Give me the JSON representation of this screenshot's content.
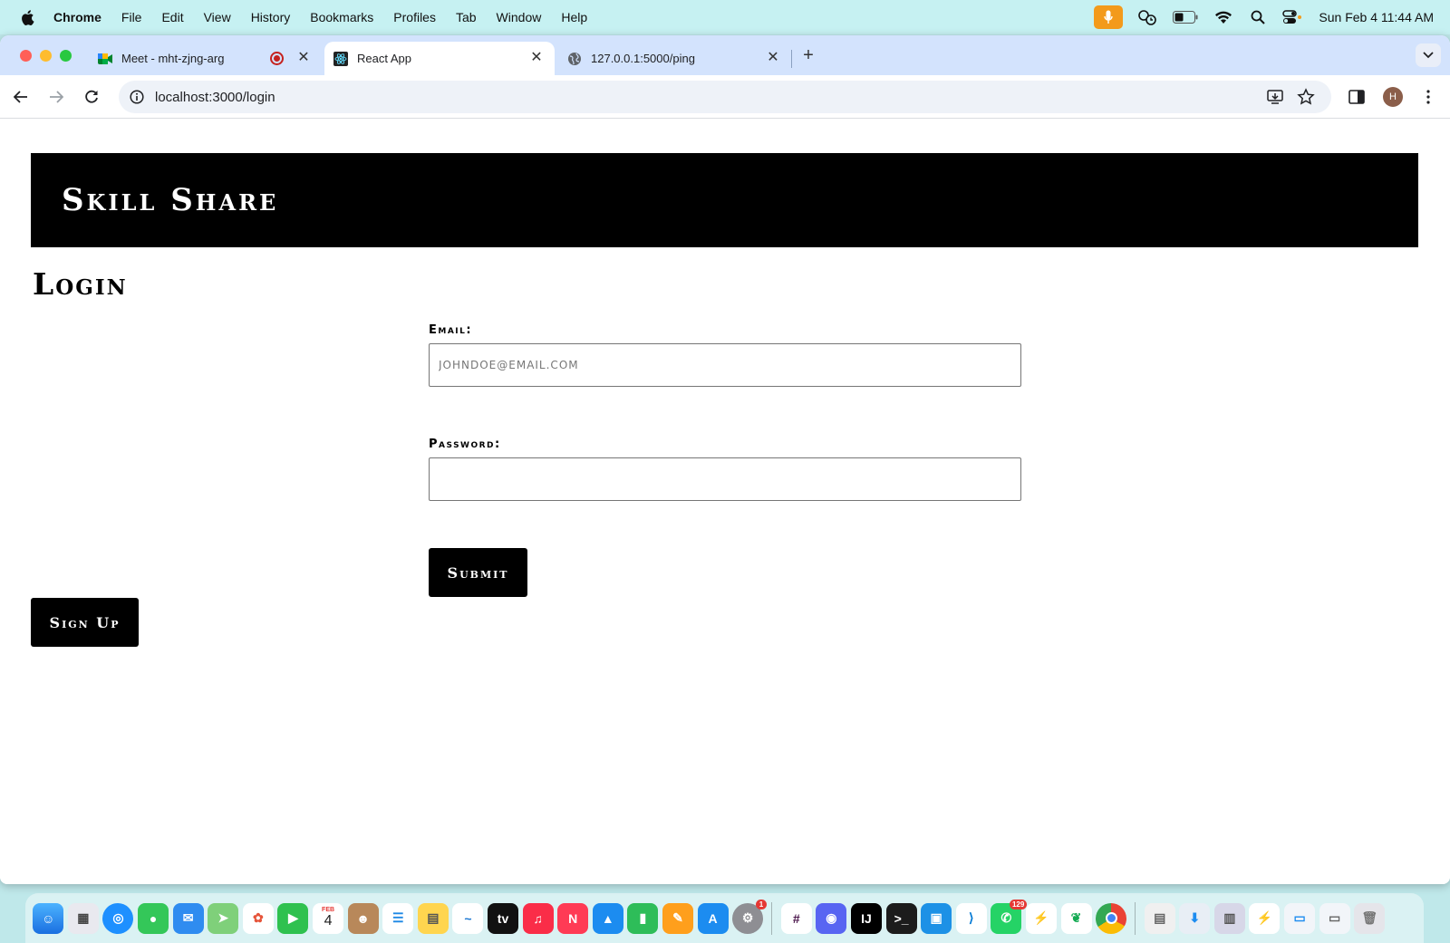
{
  "menubar": {
    "app_name": "Chrome",
    "items": [
      "File",
      "Edit",
      "View",
      "History",
      "Bookmarks",
      "Profiles",
      "Tab",
      "Window",
      "Help"
    ],
    "clock": "Sun Feb 4  11:44 AM"
  },
  "browser": {
    "tabs": [
      {
        "title": "Meet - mht-zjng-arg",
        "icon": "google-meet-icon",
        "active": false
      },
      {
        "title": "React App",
        "icon": "react-icon",
        "active": true
      },
      {
        "title": "127.0.0.1:5000/ping",
        "icon": "globe-icon",
        "active": false
      }
    ],
    "url": "localhost:3000/login",
    "profile_initial": "H"
  },
  "page": {
    "site_title": "Skill Share",
    "heading": "Login",
    "email_label": "Email:",
    "email_placeholder": "johndoe@email.com",
    "email_value": "",
    "password_label": "Password:",
    "password_value": "",
    "submit_label": "Submit",
    "signup_label": "Sign Up"
  },
  "dock": {
    "apps": [
      "Finder",
      "Launchpad",
      "Safari",
      "Messages",
      "Mail",
      "Maps",
      "Photos",
      "FaceTime",
      "Calendar",
      "Contacts",
      "Reminders",
      "Notes",
      "Freeform",
      "TV",
      "Music",
      "News",
      "Keynote",
      "Numbers",
      "Pages",
      "App Store",
      "System Settings",
      "Slack",
      "Discord",
      "IntelliJ IDEA",
      "Terminal",
      "Docker",
      "VS Code",
      "WhatsApp",
      "Postman",
      "MongoDB Compass",
      "Chrome",
      "Preview",
      "Downloads",
      "Screenshot",
      "Finder Window",
      "Trash"
    ],
    "calendar_month": "FEB",
    "calendar_day": "4",
    "whatsapp_badge": "129",
    "settings_badge": "1"
  },
  "colors": {
    "menubar_bg": "#c6f1f2",
    "tabstrip_bg": "#d3e3fd",
    "header_bg": "#000000",
    "button_bg": "#000000",
    "mic_indicator": "#f39a1b"
  }
}
